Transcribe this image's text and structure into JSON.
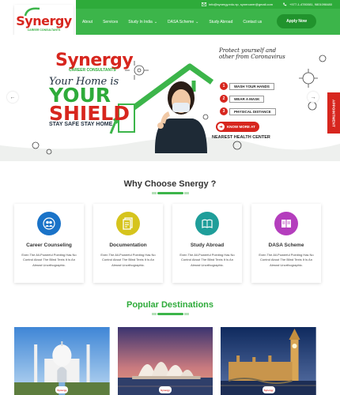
{
  "topbar": {
    "email": "info@synergy.edu.np, synercarer@gmail.com",
    "phone": "+977-1-4780081, 9801098480"
  },
  "brand": {
    "name": "Synergy",
    "tagline": "CAREER CONSULTANTS",
    "red": "#d7261e",
    "green": "#3cb54a"
  },
  "nav": {
    "items": [
      "About",
      "Services",
      "Study In India",
      "DASA Scheme",
      "Study Abroad",
      "Contact us"
    ],
    "apply_label": "Apply Now"
  },
  "hero": {
    "logo_word": "Synergy",
    "logo_tag": "CAREER CONSULTANTS",
    "line1": "Your Home is",
    "line2": "YOUR",
    "line3": "SHIELD",
    "line4": "STAY SAFE STAY HOME",
    "protect_text": "Protect yourself and other from Coronavirus",
    "steps": [
      {
        "num": "1",
        "text": "WASH YOUR HANDS"
      },
      {
        "num": "2",
        "text": "WEAR A MASK"
      },
      {
        "num": "3",
        "text": "PHYSICAL DISTANCE"
      }
    ],
    "know_more": "KNOW MORE AT",
    "nearest": "NEAREST HEALTH CENTER",
    "prev_icon": "arrow-left-icon",
    "next_icon": "arrow-right-icon"
  },
  "appointment_label": "APPOINTMENT",
  "why": {
    "title": "Why Choose Snergy ?",
    "cards": [
      {
        "title": "Career Counseling",
        "text": "Even The All-Powerful Pointing Has No Control About The Blind Texts It Is An Almost Unorthographic.",
        "icon": "people-icon",
        "color": "#1a73c8"
      },
      {
        "title": "Documentation",
        "text": "Even The All-Powerful Pointing Has No Control About The Blind Texts It Is An Almost Unorthographic.",
        "icon": "document-icon",
        "color": "#d6c41d"
      },
      {
        "title": "Study Abroad",
        "text": "Even The All-Powerful Pointing Has No Control About The Blind Texts It Is An Almost Unorthographic.",
        "icon": "book-icon",
        "color": "#1f9e9a"
      },
      {
        "title": "DASA Scheme",
        "text": "Even The All-Powerful Pointing Has No Control About The Blind Texts It Is An Almost Unorthographic.",
        "icon": "open-book-icon",
        "color": "#b43ebd"
      }
    ]
  },
  "popular": {
    "title": "Popular Destinations",
    "destinations": [
      {
        "place": "India",
        "icon": "taj-mahal-image"
      },
      {
        "place": "Australia",
        "icon": "sydney-opera-house-image"
      },
      {
        "place": "United Kingdom",
        "icon": "big-ben-image"
      }
    ],
    "badge": "Synergy"
  }
}
